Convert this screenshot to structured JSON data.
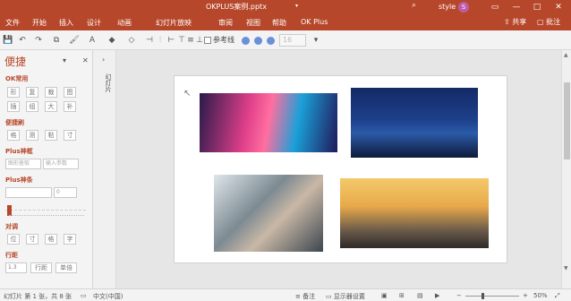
{
  "titlebar": {
    "title": "OKPLUS案例.pptx",
    "caret": "▾",
    "search_icon": "⌕",
    "user_name": "style",
    "avatar_initial": "S",
    "minimize": "—",
    "restore": "▭",
    "maximize": "□",
    "close": "✕",
    "color": "#b7472a"
  },
  "menubar": {
    "items": [
      "文件",
      "开始",
      "插入",
      "设计",
      "动画",
      "幻灯片放映",
      "审阅",
      "视图",
      "帮助",
      "OK Plus"
    ],
    "share": "共享",
    "comments": "批注"
  },
  "toolbar": {
    "save_icon": "💾",
    "undo_icon": "↶",
    "redo_icon": "↷",
    "format_painter_icon": "🖌",
    "copy_icon": "⧉",
    "font_color_icon": "A",
    "fill_color_icon": "◆",
    "shape_icon": "◇",
    "align_left_icon": "⊣",
    "align_center_icon": "⫶",
    "align_right_icon": "⊢",
    "align_top_icon": "⊤",
    "align_middle_icon": "≡",
    "align_bottom_icon": "⊥",
    "distribute_icon": "⊞",
    "reference_line_label": "参考线",
    "grid_size_value": "16",
    "more_icon": "▾"
  },
  "taskpane": {
    "title": "便捷",
    "pin_icon": "▾",
    "close_icon": "✕",
    "section_ok": "OK常用",
    "ok_row1": [
      "形",
      "复",
      "裁",
      "图"
    ],
    "ok_row2": [
      "插",
      "组",
      "大",
      "补"
    ],
    "section_quick": "便捷刷",
    "quick_row": [
      "格",
      "测",
      "粘",
      "寸"
    ],
    "section_plus_frame": "Plus神框",
    "plus_frame_input1": "图形鉴取",
    "plus_frame_input2": "输入参数",
    "section_plus_line": "Plus神条",
    "plus_line_value": "0",
    "section_align": "对调",
    "align_row": [
      "位",
      "寸",
      "格",
      "字"
    ],
    "section_spacing": "行距",
    "spacing_value": "1.3",
    "spacing_btn1": "行距",
    "spacing_btn2": "单倍"
  },
  "collapse_panel": {
    "arrow": "›",
    "label": "幻灯片"
  },
  "statusbar": {
    "slide_info": "幻灯片 第 1 张，共 8 张",
    "notes_icon": "▭",
    "language": "中文(中国)",
    "notes_label": "备注",
    "display_settings": "显示器设置",
    "zoom_minus": "−",
    "zoom_plus": "+",
    "zoom": "50%"
  }
}
